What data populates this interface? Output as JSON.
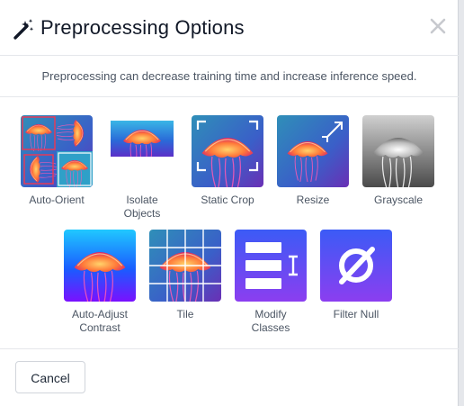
{
  "dialog": {
    "title": "Preprocessing Options",
    "title_icon": "magic-wand-icon",
    "close_icon": "close-icon",
    "description": "Preprocessing can decrease training time and increase inference speed."
  },
  "options": [
    {
      "label": "Auto-Orient",
      "icon": "auto-orient-thumbnail"
    },
    {
      "label_lines": [
        "Isolate",
        "Objects"
      ],
      "icon": "isolate-objects-thumbnail"
    },
    {
      "label": "Static Crop",
      "icon": "static-crop-thumbnail"
    },
    {
      "label": "Resize",
      "icon": "resize-thumbnail"
    },
    {
      "label": "Grayscale",
      "icon": "grayscale-thumbnail"
    },
    {
      "label_lines": [
        "Auto-Adjust",
        "Contrast"
      ],
      "icon": "auto-adjust-contrast-thumbnail"
    },
    {
      "label": "Tile",
      "icon": "tile-thumbnail"
    },
    {
      "label_lines": [
        "Modify",
        "Classes"
      ],
      "icon": "modify-classes-icon"
    },
    {
      "label": "Filter Null",
      "icon": "filter-null-icon"
    }
  ],
  "footer": {
    "cancel_label": "Cancel"
  },
  "colors": {
    "accent_blue": "#3b5bf6",
    "accent_purple": "#8b3ef0",
    "label_gray": "#4b5563"
  }
}
